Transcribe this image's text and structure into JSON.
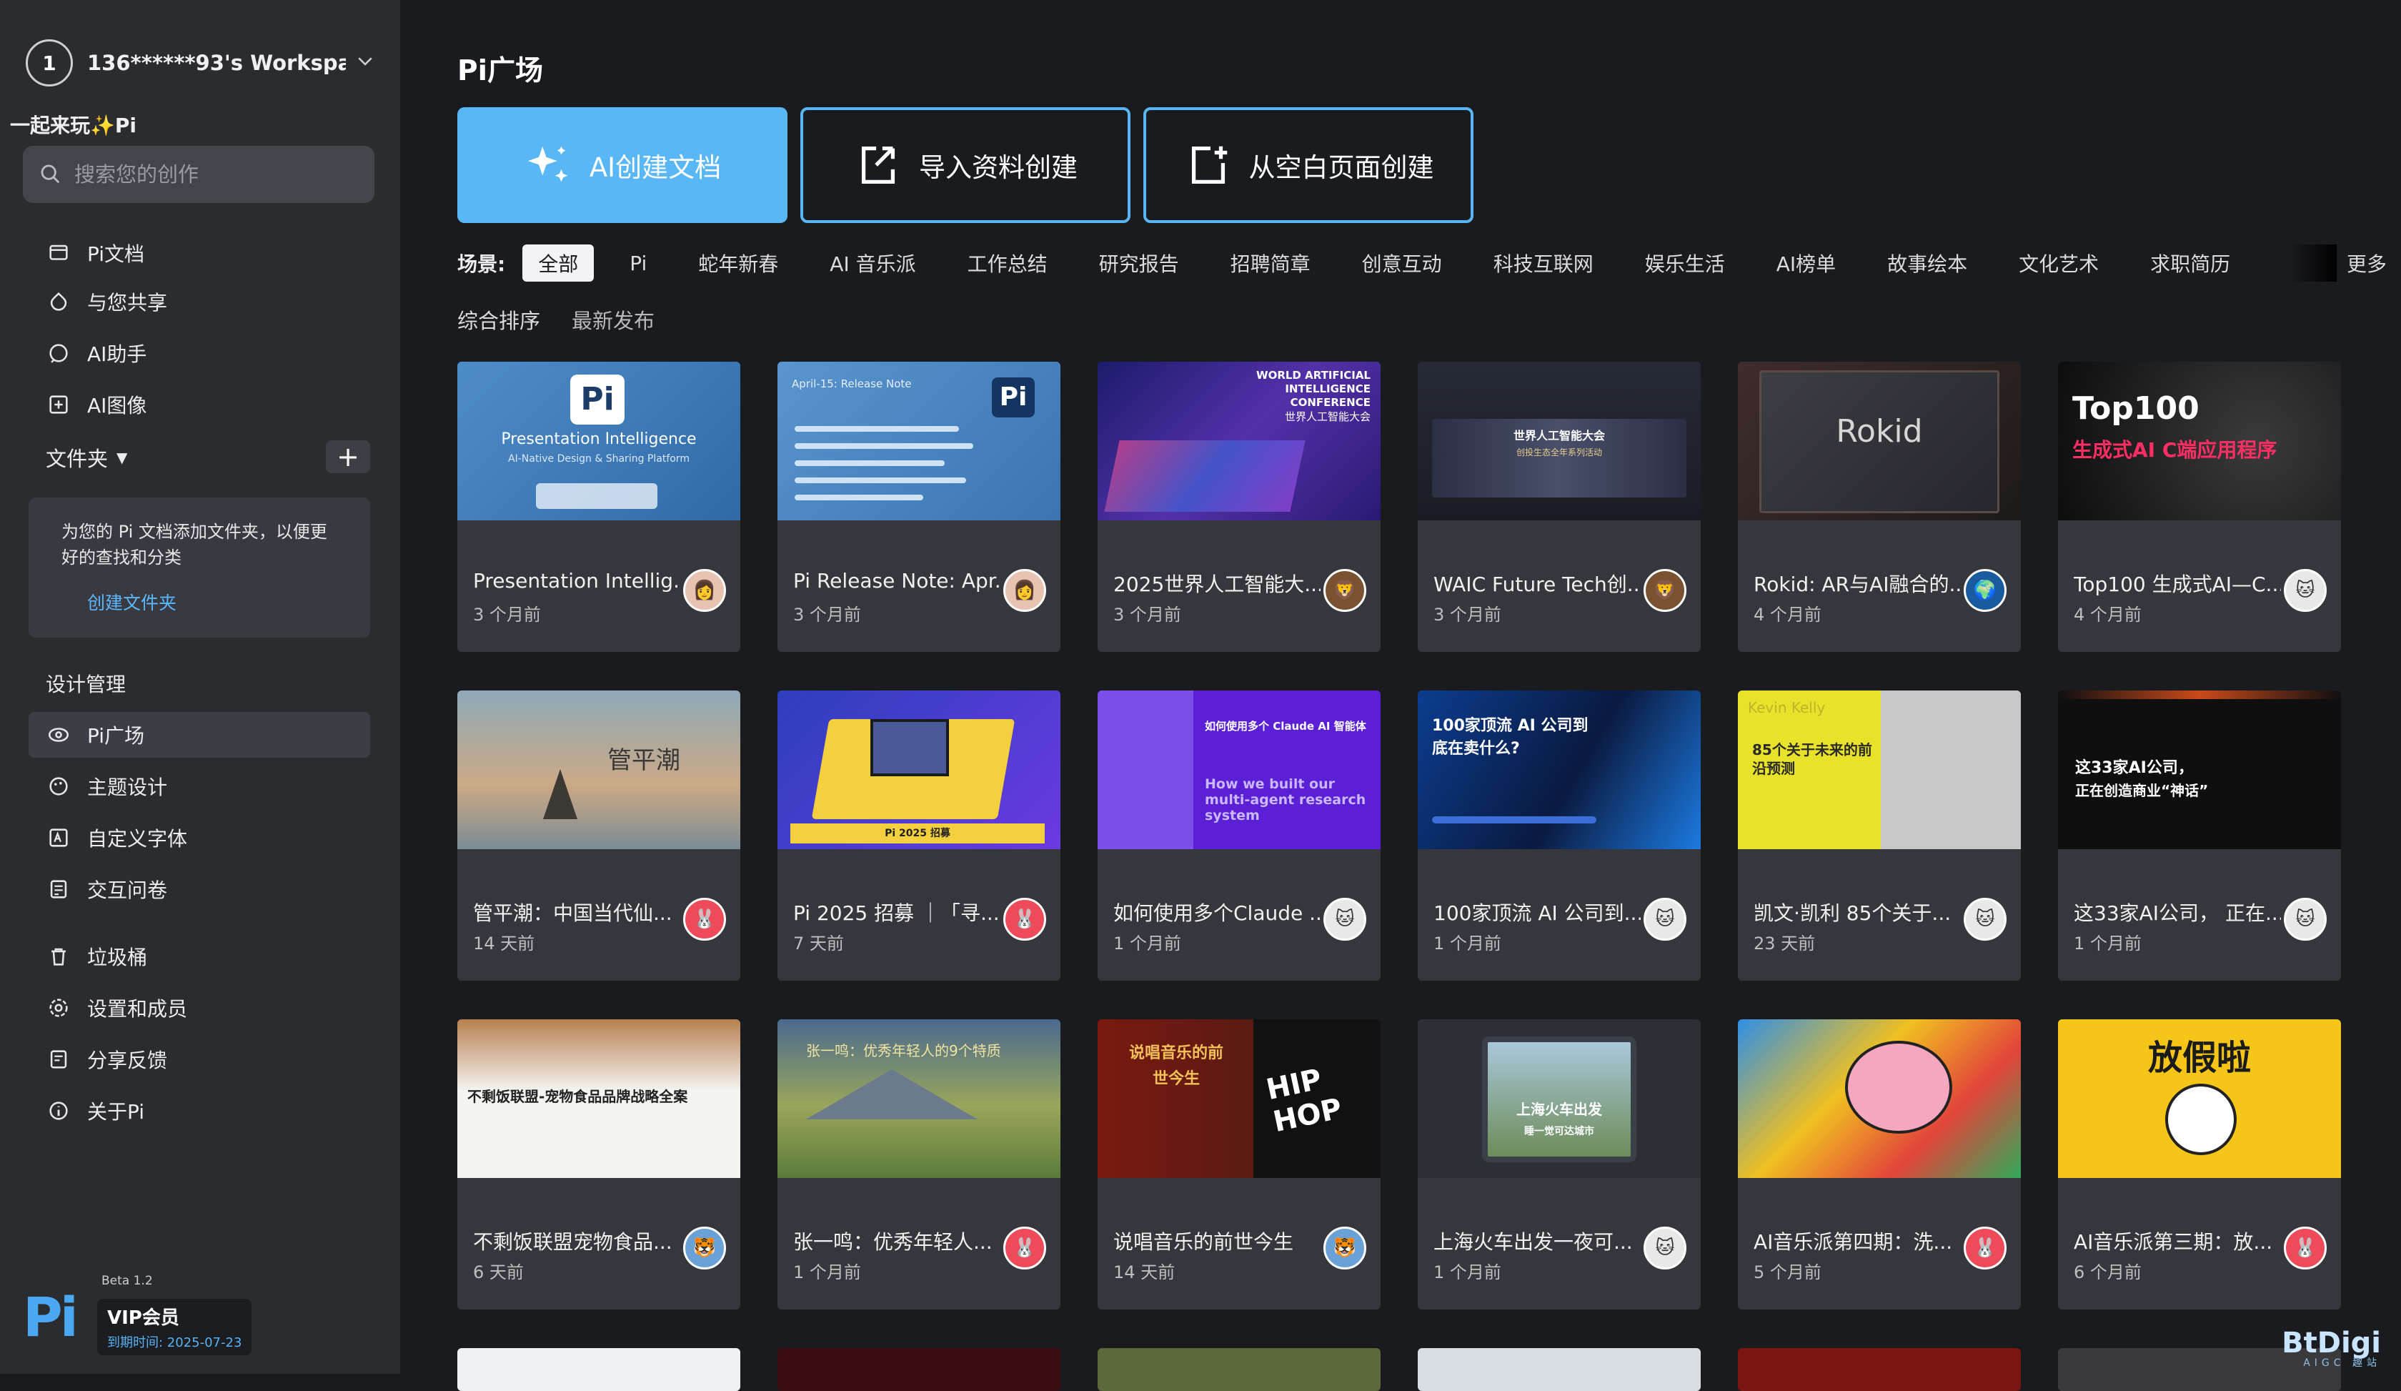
{
  "sidebar": {
    "workspace_num": "1",
    "workspace_name": "136******93's Workspa...",
    "greeting": "一起来玩✨Pi",
    "search_placeholder": "搜索您的创作",
    "nav": [
      {
        "label": "Pi文档",
        "icon": "document-icon"
      },
      {
        "label": "与您共享",
        "icon": "share-icon"
      },
      {
        "label": "AI助手",
        "icon": "chat-icon"
      },
      {
        "label": "AI图像",
        "icon": "image-icon"
      }
    ],
    "folder_label": "文件夹",
    "folder_hint": "为您的 Pi 文档添加文件夹，以便更好的查找和分类",
    "folder_create": "创建文件夹",
    "design_label": "设计管理",
    "design_nav": [
      {
        "label": "Pi广场",
        "icon": "plaza-icon"
      },
      {
        "label": "主题设计",
        "icon": "palette-icon"
      },
      {
        "label": "自定义字体",
        "icon": "font-icon"
      },
      {
        "label": "交互问卷",
        "icon": "form-icon"
      }
    ],
    "bottom_nav": [
      {
        "label": "垃圾桶",
        "icon": "trash-icon"
      },
      {
        "label": "设置和成员",
        "icon": "settings-icon"
      },
      {
        "label": "分享反馈",
        "icon": "feedback-icon"
      },
      {
        "label": "关于Pi",
        "icon": "info-icon"
      }
    ],
    "brand": {
      "logo": "Pi",
      "beta": "Beta 1.2",
      "vip": "VIP会员",
      "expiry": "到期时间: 2025-07-23"
    }
  },
  "main": {
    "title": "Pi广场",
    "actions": {
      "ai": "AI创建文档",
      "import": "导入资料创建",
      "blank": "从空白页面创建"
    },
    "filter_label": "场景:",
    "filters": [
      "全部",
      "Pi",
      "蛇年新春",
      "AI 音乐派",
      "工作总结",
      "研究报告",
      "招聘简章",
      "创意互动",
      "科技互联网",
      "娱乐生活",
      "AI榜单",
      "故事绘本",
      "文化艺术",
      "求职简历"
    ],
    "more": "更多",
    "sorts": [
      "综合排序",
      "最新发布"
    ],
    "cards": [
      {
        "title": "Presentation Intellig...",
        "time": "3 个月前",
        "thumb_text": "Presentation Intelligence",
        "thumb_sub": "AI-Native Design & Sharing Platform"
      },
      {
        "title": "Pi Release Note: Apr...",
        "time": "3 个月前",
        "thumb_text": "April-15: Release Note",
        "thumb_sub": ""
      },
      {
        "title": "2025世界人工智能大...",
        "time": "3 个月前",
        "thumb_text": "WORLD ARTIFICIAL INTELLIGENCE CONFERENCE",
        "thumb_sub": "世界人工智能大会"
      },
      {
        "title": "WAIC Future Tech创...",
        "time": "3 个月前",
        "thumb_text": "世界人工智能大会",
        "thumb_sub": "创投生态全年系列活动"
      },
      {
        "title": "Rokid: AR与AI融合的...",
        "time": "4 个月前",
        "thumb_text": "Rokid",
        "thumb_sub": ""
      },
      {
        "title": "Top100 生成式AI—C...",
        "time": "4 个月前",
        "thumb_text": "Top100",
        "thumb_sub": "生成式AI C端应用程序"
      },
      {
        "title": "管平潮：中国当代仙...",
        "time": "14 天前",
        "thumb_text": "管平潮",
        "thumb_sub": ""
      },
      {
        "title": "Pi 2025 招募 ｜「寻...",
        "time": "7 天前",
        "thumb_text": "Pi 2025 招募",
        "thumb_sub": ""
      },
      {
        "title": "如何使用多个Claude ...",
        "time": "1 个月前",
        "thumb_text": "如何使用多个 Claude AI 智能体",
        "thumb_sub": "How we built our multi-agent research system"
      },
      {
        "title": "100家顶流 AI 公司到...",
        "time": "1 个月前",
        "thumb_text": "100家顶流 AI 公司到底在卖什么?",
        "thumb_sub": ""
      },
      {
        "title": "凯文·凯利 85个关于...",
        "time": "23 天前",
        "thumb_text": "85个关于未来的前沿预测",
        "thumb_sub": "Kevin Kelly"
      },
      {
        "title": "这33家AI公司， 正在...",
        "time": "1 个月前",
        "thumb_text": "这33家AI公司，",
        "thumb_sub": "正在创造商业“神话”"
      },
      {
        "title": "不剩饭联盟宠物食品...",
        "time": "6 天前",
        "thumb_text": "不剩饭联盟-宠物食品品牌战略全案",
        "thumb_sub": ""
      },
      {
        "title": "张一鸣：优秀年轻人...",
        "time": "1 个月前",
        "thumb_text": "张一鸣：优秀年轻人的9个特质",
        "thumb_sub": ""
      },
      {
        "title": "说唱音乐的前世今生",
        "time": "14 天前",
        "thumb_text": "说唱音乐的前世今生",
        "thumb_sub": "HIP HOP"
      },
      {
        "title": "上海火车出发一夜可...",
        "time": "1 个月前",
        "thumb_text": "上海火车出发",
        "thumb_sub": "睡一觉可达城市"
      },
      {
        "title": "AI音乐派第四期：洗...",
        "time": "5 个月前",
        "thumb_text": "",
        "thumb_sub": ""
      },
      {
        "title": "AI音乐派第三期：放...",
        "time": "6 个月前",
        "thumb_text": "放假啦",
        "thumb_sub": ""
      }
    ]
  },
  "watermark": {
    "text": "BtDigi",
    "sub": "AIGC 趣站"
  }
}
